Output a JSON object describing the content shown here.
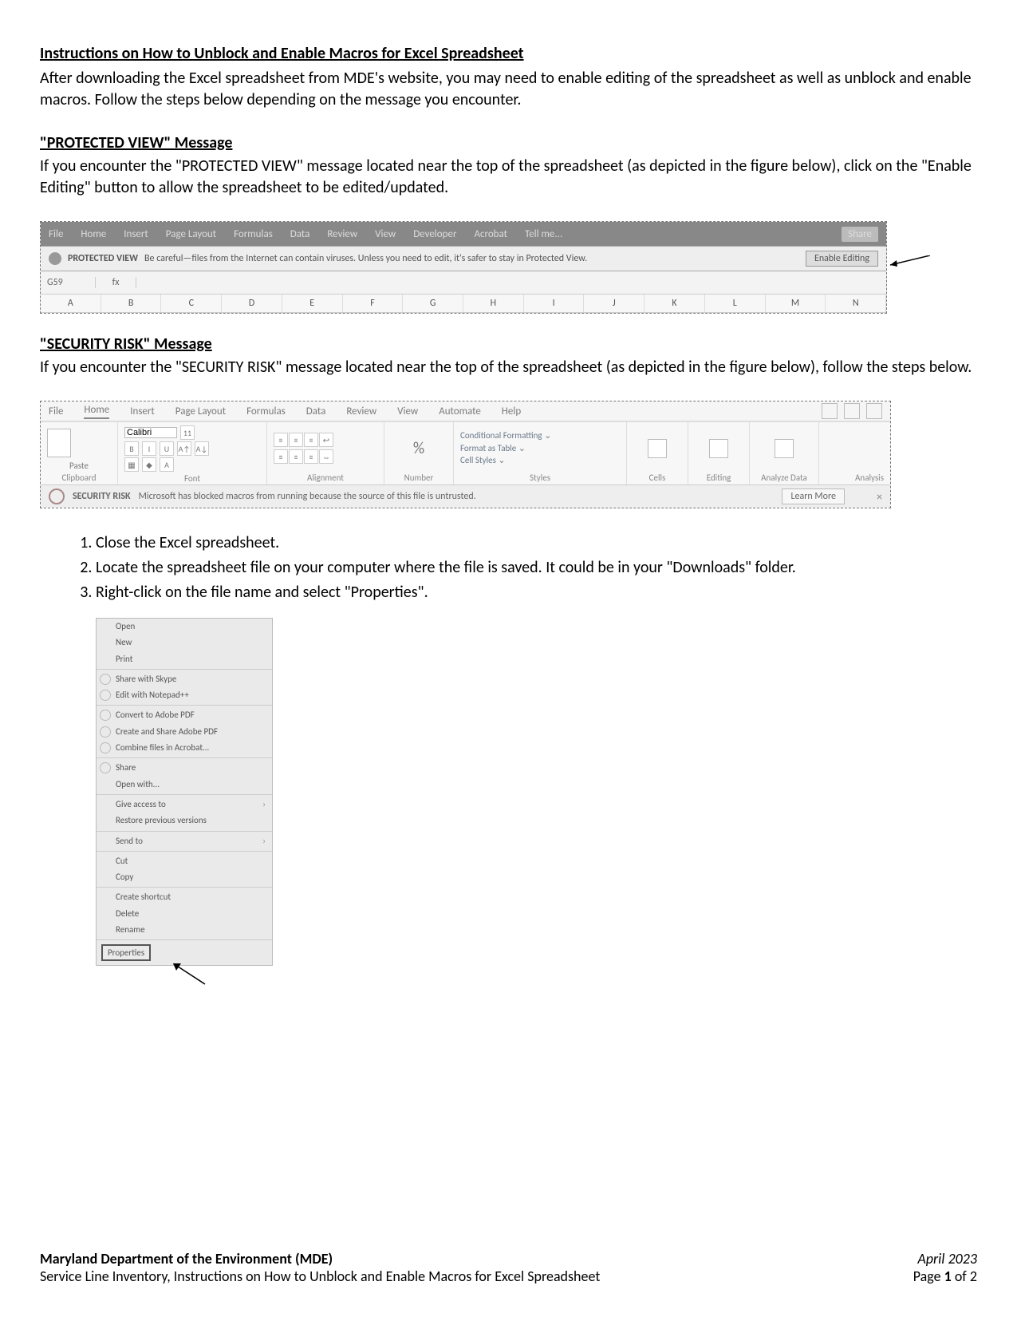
{
  "title": "Instructions on How to Unblock and Enable Macros for Excel Spreadsheet",
  "intro": "After downloading the Excel spreadsheet from MDE's website, you may need to enable editing of the spreadsheet as well as unblock and enable macros.  Follow the steps below depending on the message you encounter.",
  "section1": {
    "heading": "\"PROTECTED VIEW\" Message",
    "text": "If you encounter the \"PROTECTED VIEW\" message located near the top of the spreadsheet (as depicted in the figure below), click on the \"Enable Editing\" button to allow the spreadsheet to be edited/updated."
  },
  "fig1": {
    "tabs": [
      "File",
      "Home",
      "Insert",
      "Page Layout",
      "Formulas",
      "Data",
      "Review",
      "View",
      "Developer",
      "Acrobat",
      "Tell me..."
    ],
    "share": "Share",
    "pv_label": "PROTECTED VIEW",
    "pv_text": "Be careful—files from the Internet can contain viruses. Unless you need to edit, it's safer to stay in Protected View.",
    "pv_button": "Enable Editing",
    "cellref": "G59",
    "fx": "fx",
    "cols": [
      "A",
      "B",
      "C",
      "D",
      "E",
      "F",
      "G",
      "H",
      "I",
      "J",
      "K",
      "L",
      "M",
      "N"
    ]
  },
  "section2": {
    "heading": "\"SECURITY RISK\" Message",
    "text": "If you encounter the \"SECURITY RISK\" message located near the top of the spreadsheet (as depicted in the figure below), follow the steps below."
  },
  "fig2": {
    "tabs": [
      "File",
      "Home",
      "Insert",
      "Page Layout",
      "Formulas",
      "Data",
      "Review",
      "View",
      "Automate",
      "Help"
    ],
    "font_name": "Calibri",
    "font_size": "11",
    "percent": "%",
    "groups": {
      "clipboard": "Clipboard",
      "paste": "Paste",
      "font": "Font",
      "alignment": "Alignment",
      "number": "Number",
      "styles": "Styles",
      "cells": "Cells",
      "editing": "Editing",
      "analyze": "Analyze Data",
      "analysis": "Analysis"
    },
    "styles_items": [
      "Conditional Formatting ⌄",
      "Format as Table ⌄",
      "Cell Styles ⌄"
    ],
    "sr_label": "SECURITY RISK",
    "sr_text": "Microsoft has blocked macros from running because the source of this file is untrusted.",
    "sr_button": "Learn More",
    "close": "×"
  },
  "steps": [
    "Close the Excel spreadsheet.",
    "Locate the spreadsheet file on your computer where the file is saved.  It could be in your \"Downloads\" folder.",
    "Right-click on the file name and select \"Properties\"."
  ],
  "fig3": {
    "items_top": [
      "Open",
      "New",
      "Print"
    ],
    "items_skype": [
      "Share with Skype",
      "Edit with Notepad++"
    ],
    "items_adobe": [
      "Convert to Adobe PDF",
      "Create and Share Adobe PDF",
      "Combine files in Acrobat..."
    ],
    "items_share": [
      "Share",
      "Open with..."
    ],
    "items_access": [
      "Give access to",
      "Restore previous versions"
    ],
    "items_send": [
      "Send to"
    ],
    "items_cut": [
      "Cut",
      "Copy"
    ],
    "items_misc": [
      "Create shortcut",
      "Delete",
      "Rename"
    ],
    "properties": "Properties"
  },
  "footer": {
    "org": "Maryland Department of the Environment (MDE)",
    "sub": "Service Line Inventory, Instructions on How to Unblock and Enable Macros for Excel Spreadsheet",
    "date": "April 2023",
    "page_prefix": "Page ",
    "page_num": "1",
    "page_of": " of ",
    "page_total": "2"
  }
}
